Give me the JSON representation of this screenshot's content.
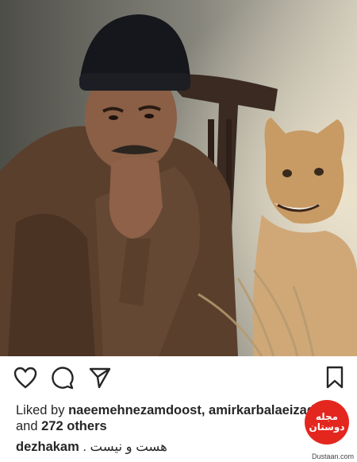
{
  "post": {
    "photo_alt": "",
    "likes_prefix": "Liked by",
    "liked_users": "naeemehnezamdoost, amirkarbalaeizadeh",
    "likes_and": "and",
    "likes_others": "272 others",
    "caption_user": "dezhakam",
    "caption_text": "هست و نیست ."
  },
  "actions": {
    "like_icon": "heart-icon",
    "comment_icon": "comment-icon",
    "share_icon": "paper-plane-icon",
    "save_icon": "bookmark-icon"
  },
  "watermark": {
    "badge_text": "مجله دوستان",
    "url": "Dustaan.com"
  },
  "colors": {
    "text": "#262626",
    "badge_red": "#e3271f"
  }
}
